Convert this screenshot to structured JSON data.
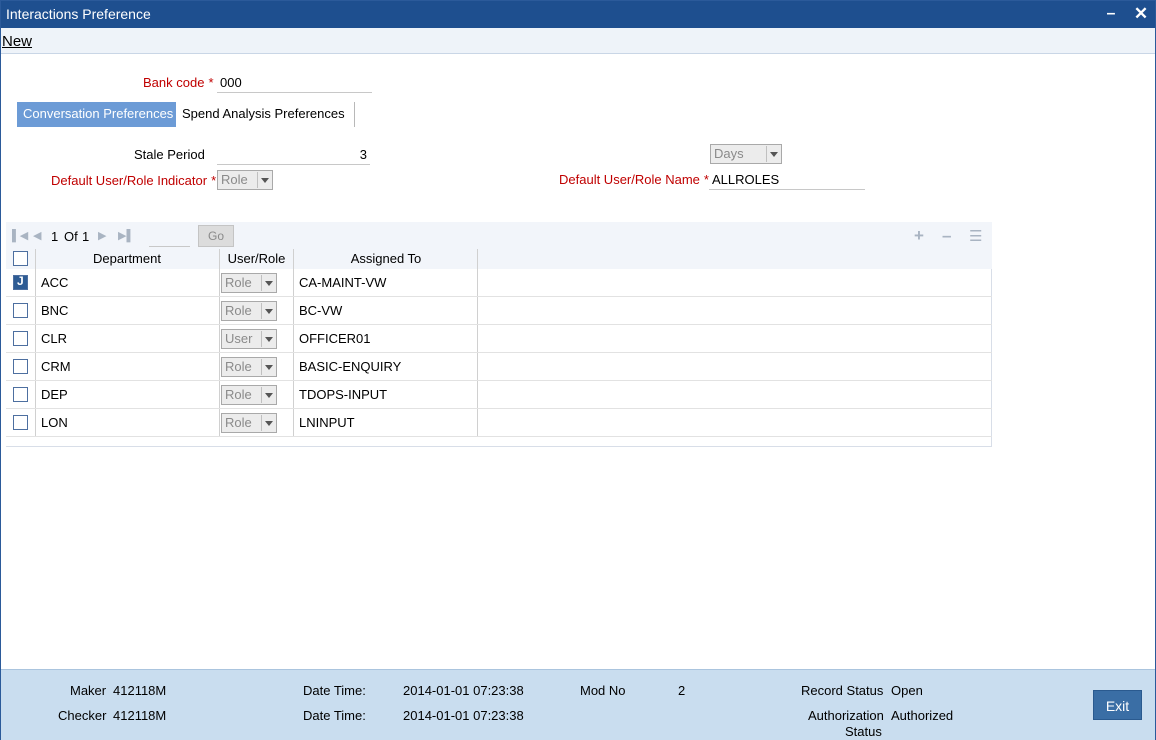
{
  "window": {
    "title": "Interactions Preference",
    "minimize_glyph": "–",
    "close_glyph": "✕"
  },
  "menu": {
    "new_label": "New"
  },
  "form": {
    "bank_code_label": "Bank code",
    "bank_code_value": "000",
    "required_mark": "*",
    "stale_period_label": "Stale Period",
    "stale_period_value": "3",
    "stale_unit": "Days",
    "default_indicator_label": "Default User/Role Indicator",
    "default_indicator_value": "Role",
    "default_name_label": "Default User/Role Name",
    "default_name_value": "ALLROLES"
  },
  "tabs": [
    {
      "label": "Conversation Preferences",
      "active": true
    },
    {
      "label": "Spend Analysis Preferences",
      "active": false
    }
  ],
  "grid_toolbar": {
    "current_page": "1",
    "of_label": "Of",
    "total_pages": "1",
    "go_label": "Go",
    "icons": [
      "first-page-icon",
      "prev-page-icon",
      "next-page-icon",
      "last-page-icon",
      "add-row-icon",
      "delete-row-icon",
      "column-view-icon"
    ]
  },
  "grid": {
    "headers": {
      "department": "Department",
      "user_role": "User/Role",
      "assigned_to": "Assigned To"
    },
    "rows": [
      {
        "department": "ACC",
        "user_role": "Role",
        "assigned_to": "CA-MAINT-VW",
        "checked": true
      },
      {
        "department": "BNC",
        "user_role": "Role",
        "assigned_to": "BC-VW",
        "checked": false
      },
      {
        "department": "CLR",
        "user_role": "User",
        "assigned_to": "OFFICER01",
        "checked": false
      },
      {
        "department": "CRM",
        "user_role": "Role",
        "assigned_to": "BASIC-ENQUIRY",
        "checked": false
      },
      {
        "department": "DEP",
        "user_role": "Role",
        "assigned_to": "TDOPS-INPUT",
        "checked": false
      },
      {
        "department": "LON",
        "user_role": "Role",
        "assigned_to": "LNINPUT",
        "checked": false
      }
    ]
  },
  "footer": {
    "maker_label": "Maker",
    "maker_value": "412118M",
    "checker_label": "Checker",
    "checker_value": "412118M",
    "date_time_label": "Date Time:",
    "maker_date_time": "2014-01-01 07:23:38",
    "checker_date_time": "2014-01-01 07:23:38",
    "mod_no_label": "Mod No",
    "mod_no_value": "2",
    "record_status_label": "Record Status",
    "record_status_value": "Open",
    "auth_status_label_1": "Authorization",
    "auth_status_label_2": "Status",
    "auth_status_value": "Authorized",
    "exit_label": "Exit"
  }
}
